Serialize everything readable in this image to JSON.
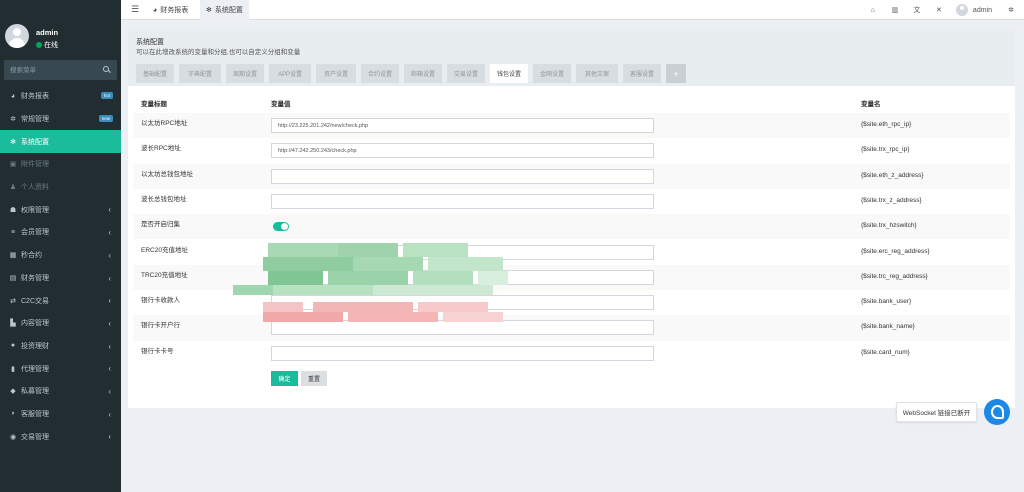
{
  "sidebar": {
    "user_name": "admin",
    "user_status": "在线",
    "search_placeholder": "搜索菜单",
    "items": [
      {
        "label": "财务报表",
        "icon": "dashboard-icon",
        "glyph": "◕",
        "badge": "hot",
        "badge_color": "#3c8dbc"
      },
      {
        "label": "常规管理",
        "icon": "cogs-icon",
        "glyph": "✲",
        "badge": "new",
        "badge_color": "#3c8dbc"
      },
      {
        "label": "系统配置",
        "icon": "gear-icon",
        "glyph": "✻",
        "active": true
      },
      {
        "label": "附件管理",
        "icon": "file-image-icon",
        "glyph": "▣",
        "dim": true
      },
      {
        "label": "个人资料",
        "icon": "user-icon",
        "glyph": "♟",
        "dim": true
      },
      {
        "label": "权限管理",
        "icon": "group-icon",
        "glyph": "☗",
        "chevron": true
      },
      {
        "label": "会员管理",
        "icon": "list-icon",
        "glyph": "≡",
        "chevron": true
      },
      {
        "label": "秒合约",
        "icon": "calendar-icon",
        "glyph": "▦",
        "chevron": true
      },
      {
        "label": "财务管理",
        "icon": "book-icon",
        "glyph": "▤",
        "chevron": true
      },
      {
        "label": "C2C交易",
        "icon": "exchange-icon",
        "glyph": "⇄",
        "chevron": true
      },
      {
        "label": "内容管理",
        "icon": "chart-icon",
        "glyph": "▙",
        "chevron": true
      },
      {
        "label": "投资理财",
        "icon": "coin-icon",
        "glyph": "●",
        "chevron": true
      },
      {
        "label": "代理管理",
        "icon": "briefcase-icon",
        "glyph": "▮",
        "chevron": true
      },
      {
        "label": "私募管理",
        "icon": "diamond-icon",
        "glyph": "◆",
        "chevron": true
      },
      {
        "label": "客服管理",
        "icon": "comment-icon",
        "glyph": "◗",
        "chevron": true
      },
      {
        "label": "交易管理",
        "icon": "eye-icon",
        "glyph": "◉",
        "chevron": true
      }
    ]
  },
  "topbar": {
    "tabs": [
      {
        "label": "财务报表",
        "icon": "dashboard-icon"
      },
      {
        "label": "系统配置",
        "icon": "gear-icon",
        "active": true
      }
    ],
    "user_name": "admin"
  },
  "panel": {
    "title": "系统配置",
    "description": "可以在此增改系统的变量和分组,也可以自定义分组和变量",
    "tabs": [
      "基础配置",
      "字典配置",
      "周期设置",
      "APP设置",
      "资产设置",
      "合约设置",
      "邮箱设置",
      "交易设置",
      "钱包设置",
      "金网设置",
      "其他文案",
      "客服设置"
    ],
    "active_tab": "钱包设置",
    "headers": {
      "title": "变量标题",
      "value": "变量值",
      "name": "变量名"
    },
    "rows": [
      {
        "label": "以太坊RPC地址",
        "value": "http://23.225.201.242/new/check.php",
        "var": "{$site.eth_rpc_ip}"
      },
      {
        "label": "波长RPC地址",
        "value": "http://47.242.250.243/check.php",
        "var": "{$site.trx_rpc_ip}"
      },
      {
        "label": "以太坊总钱包地址",
        "value": "",
        "var": "{$site.eth_z_address}"
      },
      {
        "label": "波长总钱包地址",
        "value": "",
        "var": "{$site.trx_z_address}"
      },
      {
        "label": "是否开启归集",
        "toggle": true,
        "var": "{$site.trx_hzswitch}"
      },
      {
        "label": "ERC20充值地址",
        "value": "",
        "var": "{$site.erc_reg_address}"
      },
      {
        "label": "TRC20充值地址",
        "value": "",
        "var": "{$site.trc_reg_address}"
      },
      {
        "label": "银行卡收款人",
        "value": "",
        "var": "{$site.bank_user}"
      },
      {
        "label": "银行卡开户行",
        "value": "",
        "var": "{$site.bank_name}"
      },
      {
        "label": "银行卡卡号",
        "value": "",
        "var": "{$site.card_num}"
      }
    ],
    "buttons": {
      "ok": "确定",
      "reset": "重置"
    }
  },
  "websocket": {
    "message": "WebSocket 链接已断开"
  },
  "colors": {
    "sidebar_bg": "#222d32",
    "accent": "#18bc9c",
    "badge_blue": "#3c8dbc",
    "ws_blue": "#1e88e5"
  }
}
